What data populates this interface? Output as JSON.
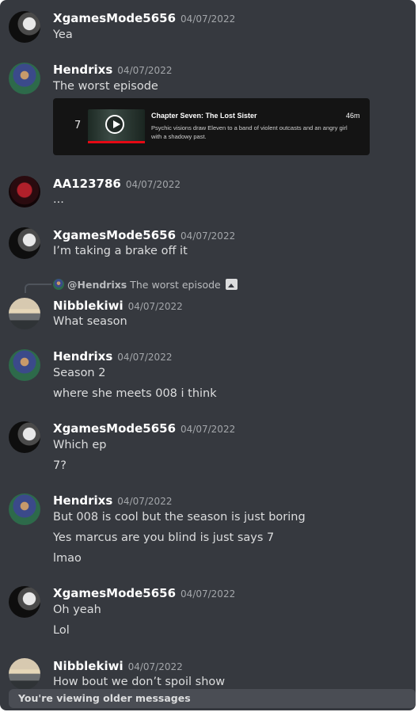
{
  "messages": [
    {
      "user": "XgamesMode5656",
      "time": "04/07/2022",
      "lines": [
        "Yea"
      ]
    },
    {
      "user": "Hendrixs",
      "time": "04/07/2022",
      "lines": [
        "The worst episode"
      ],
      "embed": {
        "episode": "7",
        "title": "Chapter Seven: The Lost Sister",
        "duration": "46m",
        "description": "Psychic visions draw Eleven to a band of violent outcasts and an angry girl with a shadowy past."
      }
    },
    {
      "user": "AA123786",
      "time": "04/07/2022",
      "lines": [
        "..."
      ]
    },
    {
      "user": "XgamesMode5656",
      "time": "04/07/2022",
      "lines": [
        "I’m taking a brake off it"
      ]
    },
    {
      "user": "Nibblekiwi",
      "time": "04/07/2022",
      "lines": [
        "What season"
      ],
      "reply": {
        "user": "@Hendrixs",
        "text": "The worst episode"
      }
    },
    {
      "user": "Hendrixs",
      "time": "04/07/2022",
      "lines": [
        "Season 2",
        "where she meets 008 i think"
      ]
    },
    {
      "user": "XgamesMode5656",
      "time": "04/07/2022",
      "lines": [
        "Which ep",
        "7?"
      ]
    },
    {
      "user": "Hendrixs",
      "time": "04/07/2022",
      "lines": [
        "But 008 is cool but the season is just boring",
        "Yes marcus are you blind is just says 7",
        "lmao"
      ]
    },
    {
      "user": "XgamesMode5656",
      "time": "04/07/2022",
      "lines": [
        "Oh yeah",
        "Lol"
      ]
    },
    {
      "user": "Nibblekiwi",
      "time": "04/07/2022",
      "lines": [
        "How bout we don’t spoil show"
      ]
    }
  ],
  "banner": "You're viewing older messages"
}
